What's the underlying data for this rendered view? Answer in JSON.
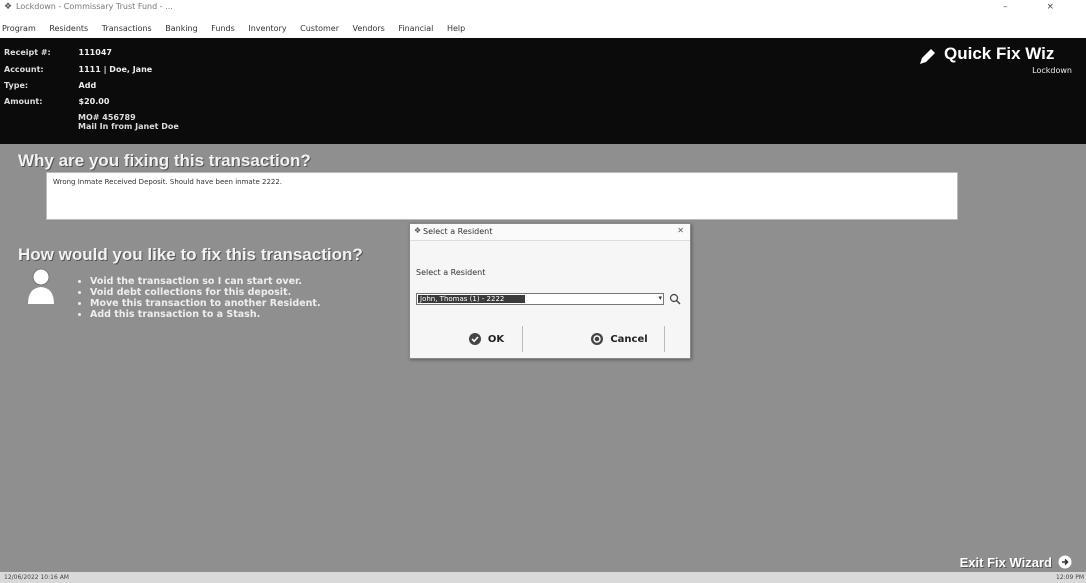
{
  "window": {
    "title": "Lockdown - Commissary Trust Fund - ..."
  },
  "menu": [
    "Program",
    "Residents",
    "Transactions",
    "Banking",
    "Funds",
    "Inventory",
    "Customer",
    "Vendors",
    "Financial",
    "Help"
  ],
  "header": {
    "fields": [
      {
        "label": "Receipt #:",
        "value": "111047"
      },
      {
        "label": "Account:",
        "value": "1111 | Doe, Jane"
      },
      {
        "label": "Type:",
        "value": "Add"
      },
      {
        "label": "Amount:",
        "value": "$20.00"
      }
    ],
    "memo_line1": "MO# 456789",
    "memo_line2": "Mail In from Janet Doe",
    "wizard_title": "Quick Fix Wiz",
    "wizard_subtitle": "Lockdown"
  },
  "why": {
    "heading": "Why are you fixing this transaction?",
    "reason": "Wrong Inmate Received Deposit.  Should have been inmate 2222."
  },
  "how": {
    "heading": "How would you like to fix this transaction?",
    "options": [
      "Void the transaction so I can start over.",
      "Void debt collections for this deposit.",
      "Move this transaction to another Resident.",
      "Add this transaction to a Stash."
    ]
  },
  "dialog": {
    "title": "Select a Resident",
    "label": "Select a Resident",
    "selected_value": "John, Thomas (1) - 2222",
    "ok_label": "OK",
    "cancel_label": "Cancel"
  },
  "exit_label": "Exit Fix Wizard",
  "status": {
    "left": "12/06/2022 10:16 AM",
    "right": "12:09 PM"
  },
  "colors": {
    "header_bg": "#0b0b0b",
    "content_bg": "#8f8f8f"
  }
}
